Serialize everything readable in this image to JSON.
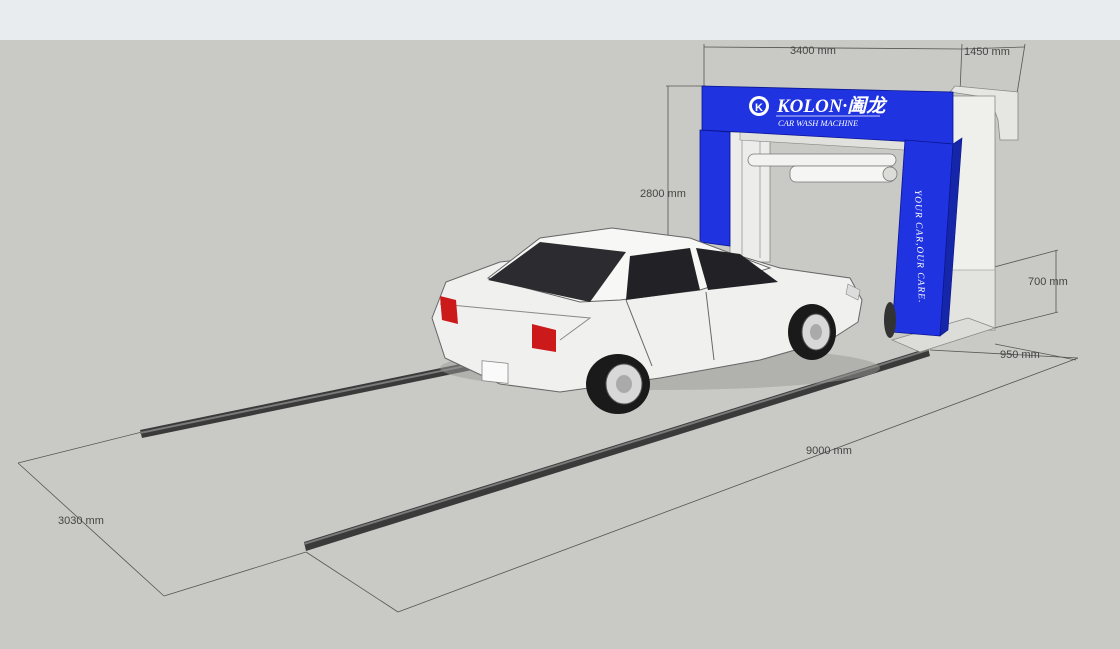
{
  "dimensions": {
    "width_top": "3400 mm",
    "depth_top": "1450 mm",
    "height": "2800 mm",
    "brush_height": "700 mm",
    "base_depth": "950 mm",
    "track_length": "9000 mm",
    "track_width": "3030 mm"
  },
  "brand": {
    "logo_letter": "K",
    "name": "KOLON·阖龙",
    "subtitle": "CAR WASH MACHINE",
    "slogan": "YOUR CAR,OUR CARE."
  },
  "colors": {
    "background": "#c9c9c5",
    "machine_blue": "#1f33e0",
    "rail": "#3a3a3a"
  }
}
